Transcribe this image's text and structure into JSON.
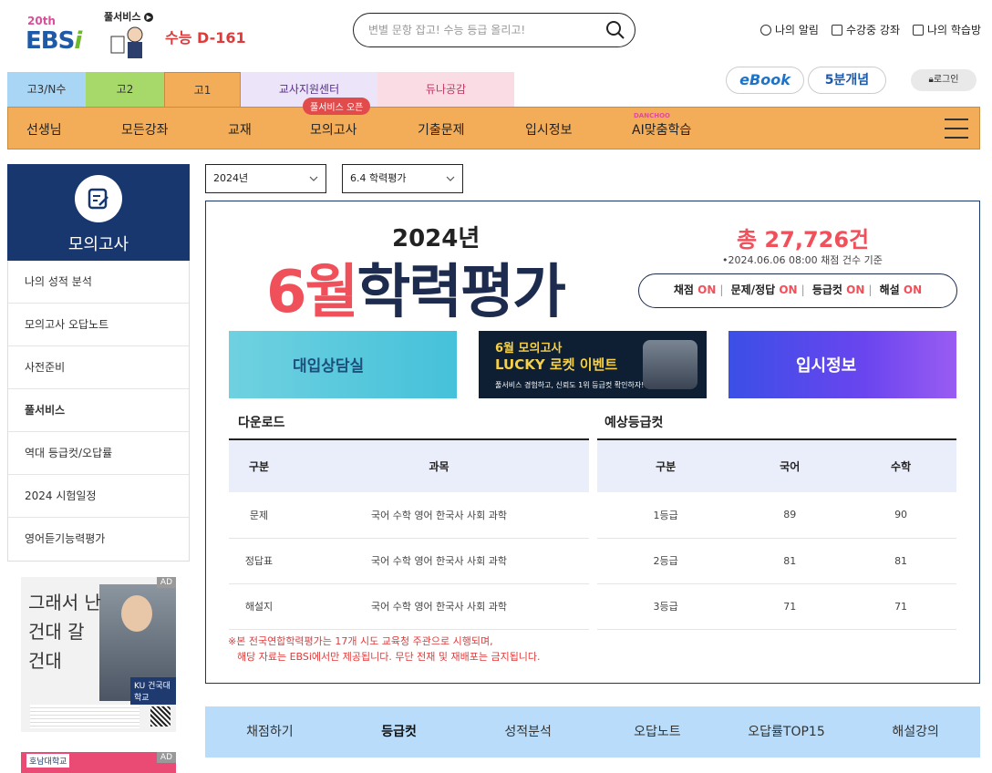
{
  "header": {
    "logo_badge": "20th",
    "logo_text": "EBS",
    "logo_i": "i",
    "full_service": "풀서비스",
    "dday": "수능 D-161",
    "search_placeholder": "변별 문항 잡고! 수능 등급 올리고!",
    "links": [
      "나의 알림",
      "수강중 강좌",
      "나의 학습방"
    ]
  },
  "grade_tabs": [
    "고3/N수",
    "고2",
    "고1",
    "교사지원센터",
    "듀나공감"
  ],
  "quick_buttons": {
    "ebook": "eBook",
    "five": "5분개념",
    "login": "로그인"
  },
  "nav": {
    "items": [
      "선생님",
      "모든강좌",
      "교재",
      "모의고사",
      "기출문제",
      "입시정보",
      "AI맞춤학습"
    ],
    "badge": "풀서비스 오픈",
    "ai_small": "DANCHOO"
  },
  "sidebar": {
    "title": "모의고사",
    "items": [
      "나의 성적 분석",
      "모의고사 오답노트",
      "사전준비",
      "풀서비스",
      "역대 등급컷/오답률",
      "2024 시험일정",
      "영어듣기능력평가"
    ]
  },
  "ads": {
    "ad1_tag": "AD",
    "ad1_text": [
      "그래서 난",
      "건대 갈",
      "건대"
    ],
    "ad1_logo": "KU 건국대학교",
    "ad2_tag": "AD",
    "ad2_logo": "호남대학교"
  },
  "filters": {
    "year": "2024년",
    "exam": "6.4 학력평가"
  },
  "exam": {
    "year_title": "2024년",
    "month": "6월",
    "title_rest": "학력평가",
    "total": "총 27,726건",
    "total_sub": "•2024.06.06 08:00 채점 건수 기준",
    "status": [
      {
        "label": "채점",
        "value": "ON"
      },
      {
        "label": "문제/정답",
        "value": "ON"
      },
      {
        "label": "등급컷",
        "value": "ON"
      },
      {
        "label": "해설",
        "value": "ON"
      }
    ]
  },
  "banners": {
    "b1": "대입상담실",
    "b2_line1": "6월 모의고사",
    "b2_line2": "LUCKY 로켓 이벤트",
    "b2_line3": "풀서비스 경험하고, 신뢰도 1위 등급컷 확인하자!",
    "b3": "입시정보"
  },
  "downloads": {
    "title": "다운로드",
    "headers": [
      "구분",
      "과목"
    ],
    "rows": [
      {
        "kind": "문제",
        "subjects": "국어 수학 영어 한국사 사회 과학"
      },
      {
        "kind": "정답표",
        "subjects": "국어 수학 영어 한국사 사회 과학"
      },
      {
        "kind": "해설지",
        "subjects": "국어 수학 영어 한국사 사회 과학"
      }
    ]
  },
  "gradecut": {
    "title": "예상등급컷",
    "headers": [
      "구분",
      "국어",
      "수학"
    ],
    "rows": [
      {
        "grade": "1등급",
        "korean": "89",
        "math": "90"
      },
      {
        "grade": "2등급",
        "korean": "81",
        "math": "81"
      },
      {
        "grade": "3등급",
        "korean": "71",
        "math": "71"
      }
    ]
  },
  "note": [
    "※본 전국연합학력평가는 17개 시도 교육청 주관으로 시행되며,",
    "해당 자료는 EBSi에서만 제공됩니다. 무단 전재 및 재배포는 금지됩니다."
  ],
  "bottom_tabs": [
    "채점하기",
    "등급컷",
    "성적분석",
    "오답노트",
    "오답률TOP15",
    "해설강의"
  ],
  "colors": {
    "accent_orange": "#f3ad59",
    "navy": "#17376e",
    "red": "#f0505a"
  }
}
